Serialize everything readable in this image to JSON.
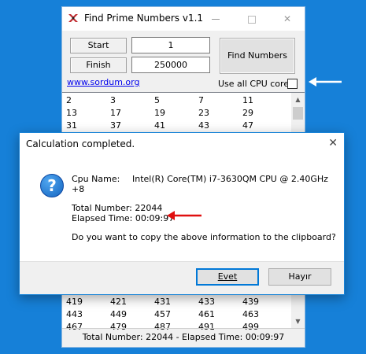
{
  "app": {
    "title": "Find Prime Numbers v1.1",
    "start_label": "Start",
    "start_value": "1",
    "finish_label": "Finish",
    "finish_value": "250000",
    "find_button": "Find Numbers",
    "link_text": "www.sordum.org",
    "cpu_checkbox_label": "Use all CPU cores",
    "cpu_checkbox_checked": false,
    "status": "Total Number: 22044  -  Elapsed Time: 00:09:97",
    "list_top_rows": [
      [
        "2",
        "3",
        "5",
        "7",
        "11"
      ],
      [
        "13",
        "17",
        "19",
        "23",
        "29"
      ],
      [
        "31",
        "37",
        "41",
        "43",
        "47"
      ]
    ],
    "list_bottom_rows": [
      [
        "419",
        "421",
        "431",
        "433",
        "439"
      ],
      [
        "443",
        "449",
        "457",
        "461",
        "463"
      ],
      [
        "467",
        "479",
        "487",
        "491",
        "499"
      ]
    ]
  },
  "dialog": {
    "title": "Calculation completed.",
    "cpu_label": "Cpu Name:",
    "cpu_value": "Intel(R) Core(TM) i7-3630QM CPU @ 2.40GHz",
    "cpu_value_cont": "+8",
    "total_line": "Total Number: 22044",
    "elapsed_line": "Elapsed Time: 00:09:97",
    "question": "Do you want to copy the above information to the clipboard?",
    "yes_button": "Evet",
    "no_button": "Hayır"
  },
  "colors": {
    "desktop": "#1680d8",
    "annotation_arrow_white": "#ffffff",
    "annotation_arrow_red": "#e01010",
    "dialog_border": "#1883d7"
  }
}
